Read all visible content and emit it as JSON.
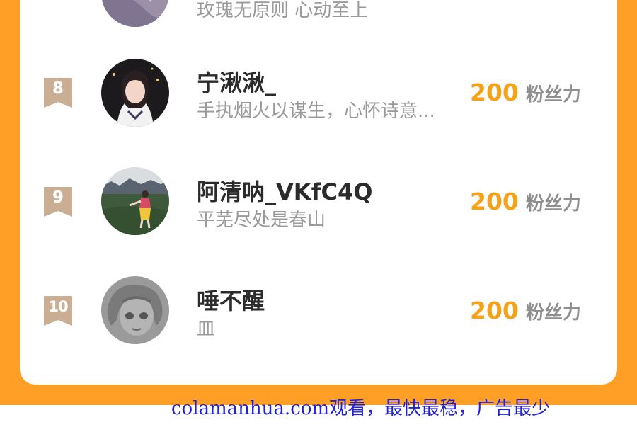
{
  "colors": {
    "background_orange": "#ff9f26",
    "card": "#ffffff",
    "score": "#f5a21b",
    "rank_badge": "#c9ae94",
    "watermark": "#2020d6"
  },
  "partial_row": {
    "bio": "玫瑰无原则 心动至上"
  },
  "rows": [
    {
      "rank": "8",
      "name": "宁湫湫_",
      "bio": "手执烟火以谋生，心怀诗意...",
      "score": "200",
      "unit": "粉丝力",
      "avatar_icon": "girl-portrait-avatar"
    },
    {
      "rank": "9",
      "name": "阿清呐_VKfC4Q",
      "bio": "平芜尽处是春山",
      "score": "200",
      "unit": "粉丝力",
      "avatar_icon": "field-runner-avatar"
    },
    {
      "rank": "10",
      "name": "唾不醒",
      "bio": "皿",
      "score": "200",
      "unit": "粉丝力",
      "avatar_icon": "anime-sketch-avatar"
    }
  ],
  "watermark": "colamanhua.com观看，最快最稳，广告最少"
}
